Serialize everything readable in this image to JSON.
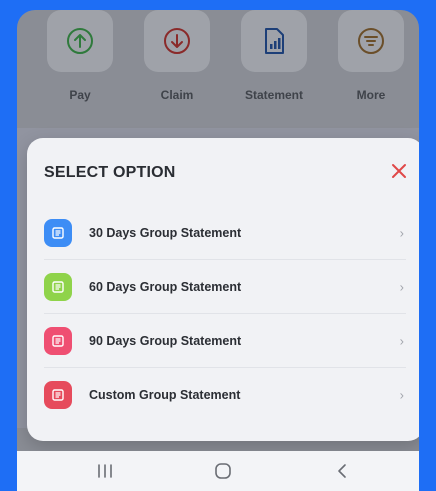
{
  "colors": {
    "outer_bg": "#1e6ef5",
    "dim_overlay": "#8a8d95",
    "close_red": "#e04848",
    "icon_blue": "#3d8df5",
    "icon_green": "#8fd34a",
    "icon_pink": "#ef4f72",
    "icon_red": "#e64b5c"
  },
  "quick_actions": [
    {
      "label": "Pay",
      "icon": "arrow-up-circle-icon"
    },
    {
      "label": "Claim",
      "icon": "arrow-down-circle-icon"
    },
    {
      "label": "Statement",
      "icon": "document-chart-icon"
    },
    {
      "label": "More",
      "icon": "filter-lines-icon"
    }
  ],
  "modal": {
    "title": "SELECT OPTION",
    "close_icon": "close-icon",
    "options": [
      {
        "label": "30 Days Group Statement",
        "icon": "statement-icon",
        "color": "blue"
      },
      {
        "label": "60 Days Group Statement",
        "icon": "statement-icon",
        "color": "green"
      },
      {
        "label": "90 Days Group Statement",
        "icon": "statement-icon",
        "color": "pink"
      },
      {
        "label": "Custom Group Statement",
        "icon": "statement-icon",
        "color": "red"
      }
    ],
    "chevron": "›"
  },
  "system_nav": {
    "recents_icon": "recents-icon",
    "home_icon": "home-icon",
    "back_icon": "back-icon"
  }
}
